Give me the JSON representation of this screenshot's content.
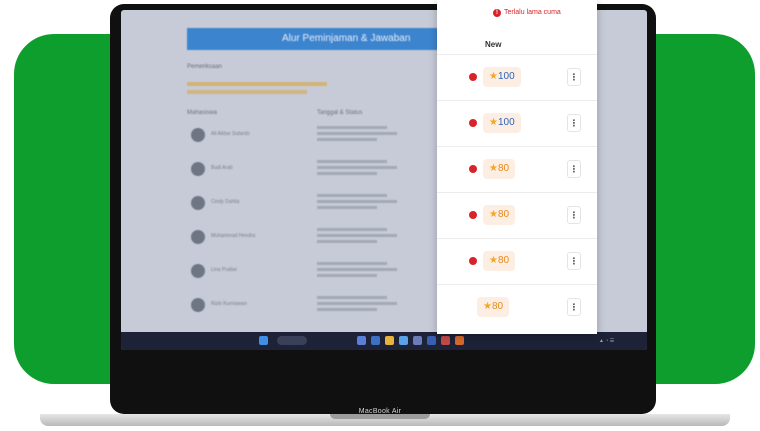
{
  "device": {
    "model": "MacBook Air"
  },
  "app": {
    "header_title": "Alur Peminjaman & Jawaban",
    "section_label": "Pemeriksaan",
    "columns": [
      "Mahasiswa",
      "Tanggal & Status"
    ],
    "rows": [
      {
        "name": "Ali Akbar Sutardo"
      },
      {
        "name": "Budi Arab"
      },
      {
        "name": "Cindy Dahlia"
      },
      {
        "name": "Muhammad Hendra"
      },
      {
        "name": "Lina Pratiwi"
      },
      {
        "name": "Rizki Kurniawan"
      }
    ]
  },
  "notifications": {
    "alert_text": "Terlalu lama cuma",
    "column_header": "New",
    "items": [
      {
        "score": "100",
        "has_alert": true,
        "score_color": "blue"
      },
      {
        "score": "100",
        "has_alert": true,
        "score_color": "blue"
      },
      {
        "score": "80",
        "has_alert": true,
        "score_color": "orange"
      },
      {
        "score": "80",
        "has_alert": true,
        "score_color": "orange"
      },
      {
        "score": "80",
        "has_alert": true,
        "score_color": "orange"
      },
      {
        "score": "80",
        "has_alert": false,
        "score_color": "orange"
      }
    ],
    "menu_glyph": "⋮",
    "star_glyph": "★"
  },
  "colors": {
    "background_card": "#0e9e2d",
    "alert_red": "#d8232a",
    "score_blue": "#2e63b8",
    "score_orange": "#e88a1a",
    "star": "#f5a623"
  }
}
